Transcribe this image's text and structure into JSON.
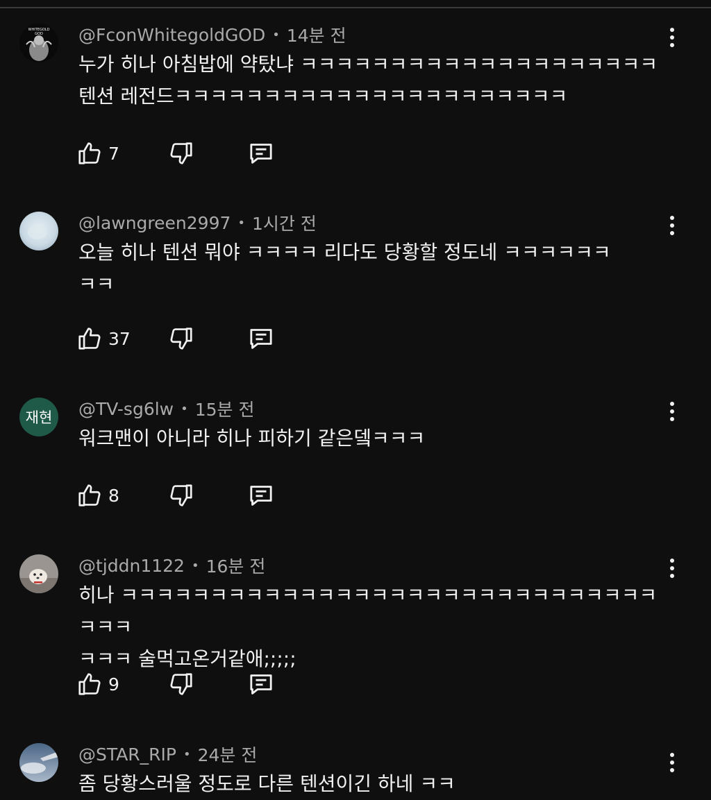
{
  "comments": [
    {
      "handle": "@FconWhitegoldGOD",
      "time": "14분 전",
      "text": "누가 히나 아침밥에 약탔냐 ㅋㅋㅋㅋㅋㅋㅋㅋㅋㅋㅋㅋㅋㅋㅋㅋㅋㅋㅋㅋ\n텐션 레전드ㅋㅋㅋㅋㅋㅋㅋㅋㅋㅋㅋㅋㅋㅋㅋㅋㅋㅋㅋㅋㅋㅋ",
      "likes": "7",
      "avatar_text": "WHITEGOLD GOD"
    },
    {
      "handle": "@lawngreen2997",
      "time": "1시간 전",
      "text": "오늘 히나 텐션 뭐야 ㅋㅋㅋㅋ 리다도 당황할 정도네 ㅋㅋㅋㅋㅋㅋ\nㅋㅋ",
      "likes": "37"
    },
    {
      "handle": "@TV-sg6lw",
      "time": "15분 전",
      "text": "워크맨이 아니라 히나 피하기 같은뎈ㅋㅋㅋ",
      "likes": "8",
      "avatar_text": "재현"
    },
    {
      "handle": "@tjddn1122",
      "time": "16분 전",
      "text": "히나 ㅋㅋㅋㅋㅋㅋㅋㅋㅋㅋㅋㅋㅋㅋㅋㅋㅋㅋㅋㅋㅋㅋㅋㅋㅋㅋㅋㅋㅋㅋㅋㅋㅋ\nㅋㅋㅋ 술먹고온거같애;;;;;",
      "likes": "9"
    },
    {
      "handle": "@STAR_RIP",
      "time": "24분 전",
      "text": "좀 당황스러울 정도로 다른 텐션이긴 하네 ㅋㅋ"
    }
  ],
  "icons": {
    "like": "thumbs-up-icon",
    "dislike": "thumbs-down-icon",
    "reply": "reply-comment-icon",
    "more": "more-vertical-icon"
  },
  "colors": {
    "background": "#0f0f0f",
    "text": "#f1f1f1",
    "meta": "#aaaaaa",
    "avatar_green": "#1f5a49"
  }
}
